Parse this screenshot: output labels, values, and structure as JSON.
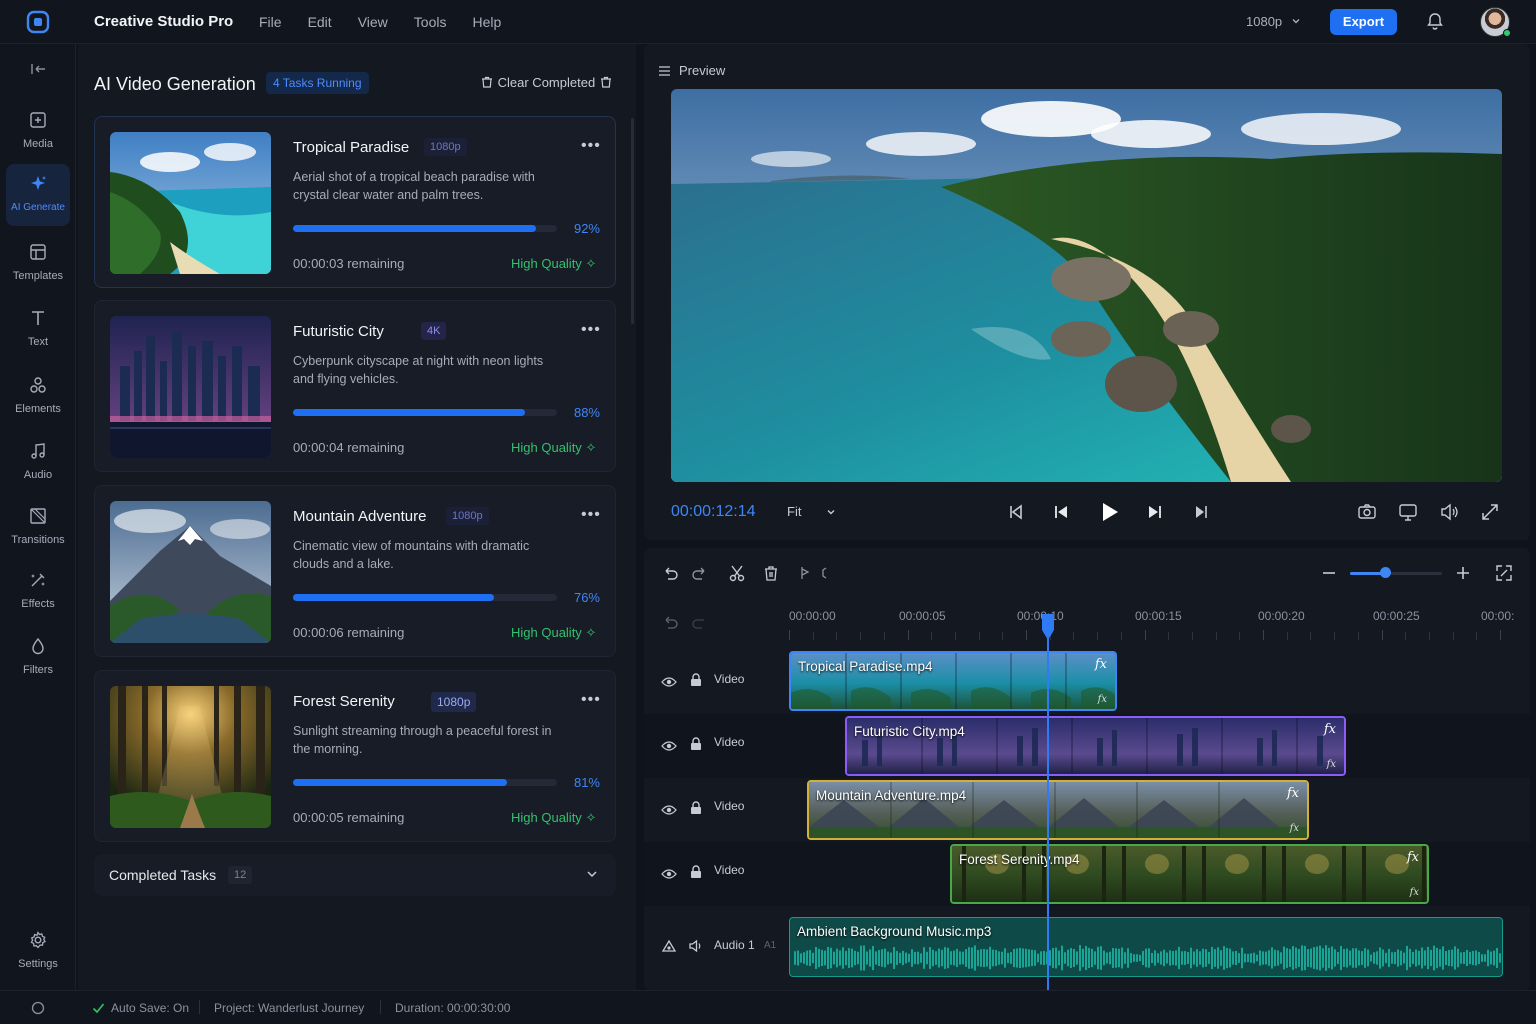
{
  "app": {
    "title": "Creative Studio Pro",
    "menu": [
      "File",
      "Edit",
      "View",
      "Tools",
      "Help"
    ],
    "resolution": "1080p",
    "export_label": "Export"
  },
  "sidebar": {
    "items": [
      {
        "label": "Media",
        "icon": "media-icon"
      },
      {
        "label": "AI Generate",
        "icon": "sparkle-icon",
        "active": true
      },
      {
        "label": "Templates",
        "icon": "templates-icon"
      },
      {
        "label": "Text",
        "icon": "text-icon"
      },
      {
        "label": "Elements",
        "icon": "elements-icon"
      },
      {
        "label": "Audio",
        "icon": "audio-icon"
      },
      {
        "label": "Transitions",
        "icon": "transitions-icon"
      },
      {
        "label": "Effects",
        "icon": "effects-icon"
      },
      {
        "label": "Filters",
        "icon": "filters-icon"
      }
    ],
    "settings_label": "Settings"
  },
  "panel": {
    "title": "AI Video Generation",
    "tasks_badge": "4 Tasks Running",
    "clear_label": "Clear Completed",
    "tasks": [
      {
        "title": "Tropical Paradise",
        "res": "1080p",
        "desc": "Aerial shot of a tropical beach paradise with crystal clear water and palm trees.",
        "progress": 0.92,
        "pct": "92%",
        "remaining": "00:00:03 remaining",
        "quality": "High Quality"
      },
      {
        "title": "Futuristic City",
        "res": "4K",
        "desc": "Cyberpunk cityscape at night with neon lights and flying vehicles.",
        "progress": 0.88,
        "pct": "88%",
        "remaining": "00:00:04 remaining",
        "quality": "High Quality"
      },
      {
        "title": "Mountain Adventure",
        "res": "1080p",
        "desc": "Cinematic view of mountains with dramatic clouds and a lake.",
        "progress": 0.76,
        "pct": "76%",
        "remaining": "00:00:06 remaining",
        "quality": "High Quality"
      },
      {
        "title": "Forest Serenity",
        "res": "1080p",
        "desc": "Sunlight streaming through a peaceful forest in the morning.",
        "progress": 0.81,
        "pct": "81%",
        "remaining": "00:00:05 remaining",
        "quality": "High Quality"
      }
    ],
    "completed_label": "Completed Tasks",
    "completed_count": "12"
  },
  "preview": {
    "title": "Preview",
    "timecode": "00:00:12:14",
    "fit": "Fit"
  },
  "timeline": {
    "ruler": [
      "00:00:00",
      "00:00:05",
      "00:00:10",
      "00:00:15",
      "00:00:20",
      "00:00:25",
      "00:00:"
    ],
    "tracks": [
      {
        "name": "Video",
        "clip": "Tropical Paradise.mp4"
      },
      {
        "name": "Video",
        "clip": "Futuristic City.mp4"
      },
      {
        "name": "Video",
        "clip": "Mountain Adventure.mp4"
      },
      {
        "name": "Video",
        "clip": "Forest Serenity.mp4"
      },
      {
        "name": "Audio 1",
        "id": "A1",
        "clip": "Ambient Background Music.mp3"
      }
    ]
  },
  "status": {
    "autosave": "Auto Save: On",
    "project": "Project: Wanderlust Journey",
    "duration": "Duration: 00:00:30:00"
  },
  "colors": {
    "accent": "#1e6ff2",
    "success": "#33c16d",
    "clip_blue": "#3f86f5",
    "clip_purple": "#8b5cf6",
    "clip_yellow": "#d4b03a",
    "clip_green": "#49a848",
    "clip_teal": "#159a8c"
  }
}
